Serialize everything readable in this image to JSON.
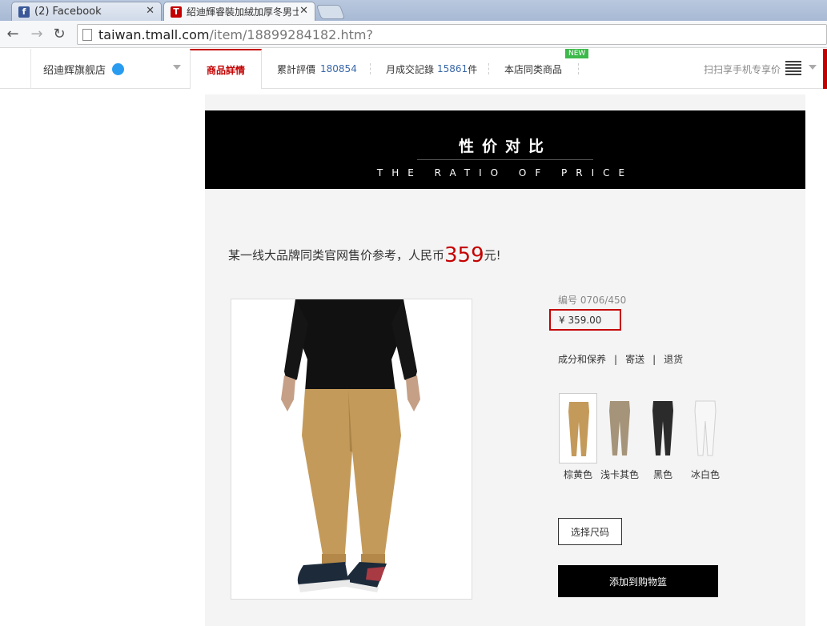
{
  "browser": {
    "tabs": [
      {
        "title": "(2) Facebook",
        "icon": "facebook-icon"
      },
      {
        "title": "紹迪輝睿裝加絨加厚冬男士",
        "icon": "tmall-icon"
      }
    ],
    "url_host": "taiwan.tmall.com",
    "url_path": "/item/18899284182.htm?"
  },
  "shop_nav": {
    "shop_name": "绍迪辉旗舰店",
    "tab_details": "商品詳情",
    "reviews_label": "累計評價",
    "reviews_count": "180854",
    "monthly_label": "月成交記錄",
    "monthly_count": "15861",
    "monthly_unit": "件",
    "similar_label": "本店同类商品",
    "new_badge": "NEW",
    "scan_label": "扫扫享手机专享价"
  },
  "banner": {
    "title_cn": "性价对比",
    "title_en": "THE RATIO OF PRICE"
  },
  "reference": {
    "prefix": "某一线大品牌同类官网售价参考，人民币",
    "amount": "359",
    "suffix": "元!"
  },
  "product": {
    "code": "编号 0706/450",
    "price": "¥ 359.00",
    "links": [
      "成分和保养",
      "寄送",
      "退货"
    ],
    "colors": [
      {
        "label": "棕黄色",
        "hex": "#c49a5a"
      },
      {
        "label": "浅卡其色",
        "hex": "#a59479"
      },
      {
        "label": "黑色",
        "hex": "#2b2b2b"
      },
      {
        "label": "冰白色",
        "hex": "#f2f2f2"
      }
    ],
    "size_button": "选择尺码",
    "cart_button": "添加到购物篮"
  },
  "colors": {
    "accent": "#c40000",
    "link": "#3a68a8"
  }
}
